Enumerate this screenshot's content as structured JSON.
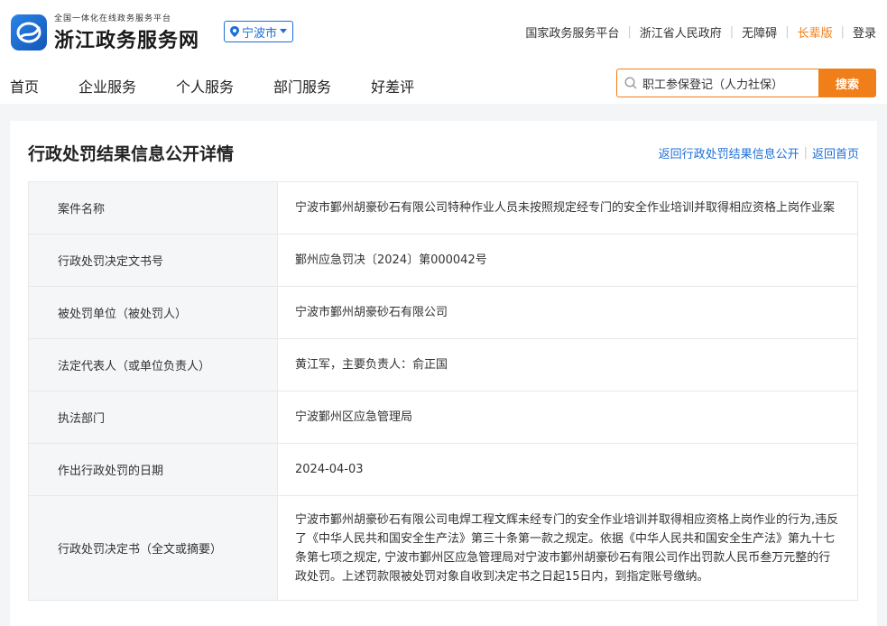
{
  "brand": {
    "subtitle": "全国一体化在线政务服务平台",
    "name": "浙江政务服务网"
  },
  "city": {
    "label": "宁波市"
  },
  "toplinks": [
    "国家政务服务平台",
    "浙江省人民政府",
    "无障碍",
    "长辈版",
    "登录"
  ],
  "nav": [
    "首页",
    "企业服务",
    "个人服务",
    "部门服务",
    "好差评"
  ],
  "search": {
    "placeholder": "职工参保登记（人力社保）",
    "button": "搜索"
  },
  "page": {
    "title": "行政处罚结果信息公开详情",
    "back_list": "返回行政处罚结果信息公开",
    "back_home": "返回首页"
  },
  "details": [
    {
      "label": "案件名称",
      "value": "宁波市鄞州胡豪砂石有限公司特种作业人员未按照规定经专门的安全作业培训并取得相应资格上岗作业案"
    },
    {
      "label": "行政处罚决定文书号",
      "value": "鄞州应急罚决〔2024〕第000042号"
    },
    {
      "label": "被处罚单位（被处罚人）",
      "value": "宁波市鄞州胡豪砂石有限公司"
    },
    {
      "label": "法定代表人（或单位负责人）",
      "value": "黄江军，主要负责人：俞正国"
    },
    {
      "label": "执法部门",
      "value": "宁波鄞州区应急管理局"
    },
    {
      "label": "作出行政处罚的日期",
      "value": "2024-04-03"
    },
    {
      "label": "行政处罚决定书（全文或摘要）",
      "value": "宁波市鄞州胡豪砂石有限公司电焊工程文辉未经专门的安全作业培训并取得相应资格上岗作业的行为,违反了《中华人民共和国安全生产法》第三十条第一款之规定。依据《中华人民共和国安全生产法》第九十七条第七项之规定, 宁波市鄞州区应急管理局对宁波市鄞州胡豪砂石有限公司作出罚款人民币叁万元整的行政处罚。上述罚款限被处罚对象自收到决定书之日起15日内，到指定账号缴纳。"
    }
  ]
}
